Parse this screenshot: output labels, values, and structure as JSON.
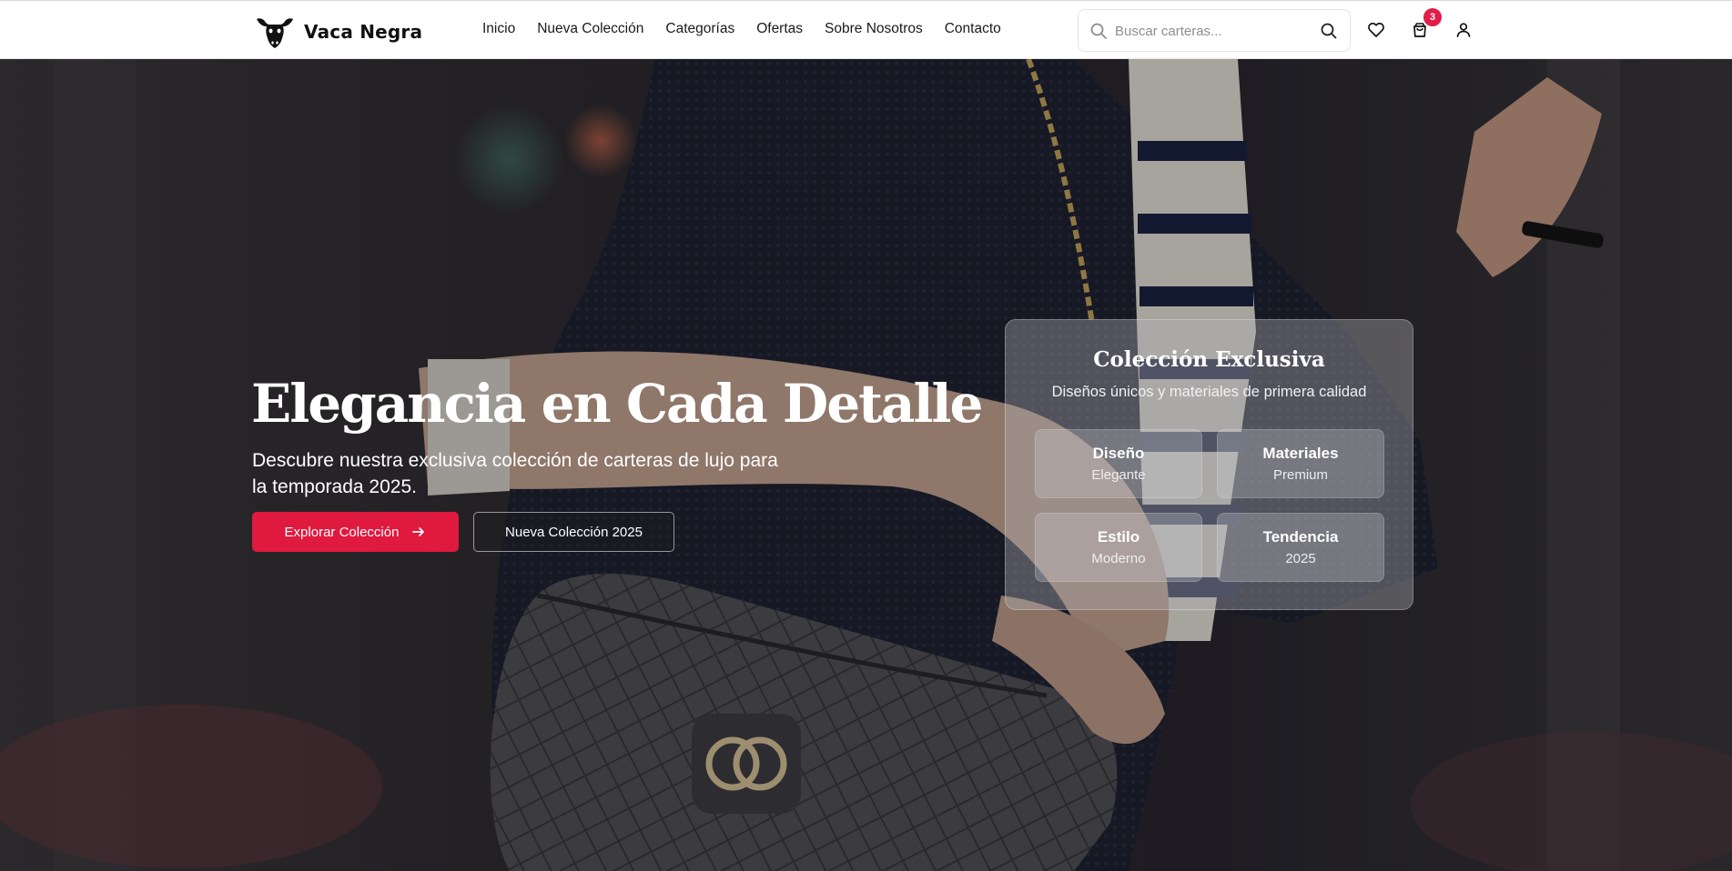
{
  "brand": {
    "name": "Vaca Negra",
    "logo_icon": "cow-head-icon"
  },
  "nav": {
    "items": [
      {
        "label": "Inicio"
      },
      {
        "label": "Nueva Colección"
      },
      {
        "label": "Categorías"
      },
      {
        "label": "Ofertas"
      },
      {
        "label": "Sobre Nosotros"
      },
      {
        "label": "Contacto"
      }
    ]
  },
  "search": {
    "placeholder": "Buscar carteras...",
    "value": ""
  },
  "header_icons": {
    "wishlist": "heart-icon",
    "cart": "shopping-bag-icon",
    "account": "user-icon",
    "cart_count": "3"
  },
  "hero": {
    "title": "Elegancia en Cada Detalle",
    "subtitle": "Descubre nuestra exclusiva colección de carteras de lujo para la temporada 2025.",
    "primary_button": "Explorar Colección",
    "secondary_button": "Nueva Colección 2025"
  },
  "feature_card": {
    "title": "Colección Exclusiva",
    "subtitle": "Diseños únicos y materiales de primera calidad",
    "features": [
      {
        "title": "Diseño",
        "value": "Elegante"
      },
      {
        "title": "Materiales",
        "value": "Premium"
      },
      {
        "title": "Estilo",
        "value": "Moderno"
      },
      {
        "title": "Tendencia",
        "value": "2025"
      }
    ]
  },
  "colors": {
    "accent": "#e0193f",
    "badge": "#e11d48",
    "header_bg": "#ffffff",
    "hero_overlay": "#2b2829"
  }
}
